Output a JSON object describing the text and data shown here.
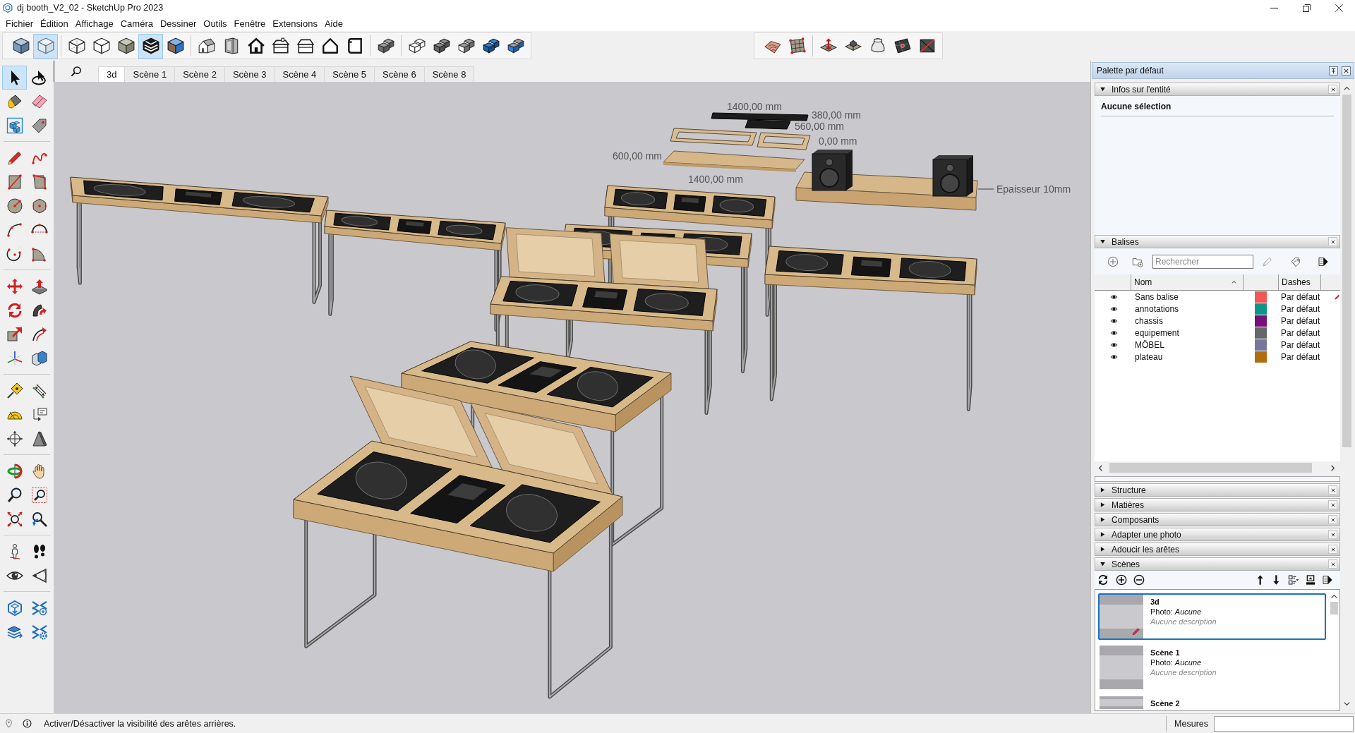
{
  "window": {
    "title": "dj booth_V2_02 - SketchUp Pro 2023"
  },
  "menu": [
    "Fichier",
    "Édition",
    "Affichage",
    "Caméra",
    "Dessiner",
    "Outils",
    "Fenêtre",
    "Extensions",
    "Aide"
  ],
  "toolbar": {
    "groups": [
      [
        {
          "selected": false
        },
        {
          "selected": true
        }
      ],
      [
        {
          "selected": false
        },
        {
          "selected": false
        },
        {
          "selected": false
        },
        {
          "selected": true
        },
        {
          "selected": false
        }
      ],
      [
        {
          "selected": false
        },
        {
          "selected": false
        },
        {
          "selected": false
        },
        {
          "selected": false
        },
        {
          "selected": false
        },
        {
          "selected": false
        },
        {
          "selected": false
        }
      ],
      [
        {
          "selected": false
        }
      ],
      [
        {
          "selected": false
        },
        {
          "selected": false
        },
        {
          "selected": false
        },
        {
          "selected": false
        },
        {
          "selected": false
        }
      ]
    ]
  },
  "sandbox_toolbar": {
    "groups": [
      [
        {
          "selected": false
        },
        {
          "selected": false
        }
      ],
      [
        {
          "selected": false
        },
        {
          "selected": false
        },
        {
          "selected": false
        },
        {
          "selected": false
        },
        {
          "selected": false
        }
      ]
    ]
  },
  "tool_palette": {
    "groups": [
      [
        {
          "selected": true
        },
        {
          "selected": false
        },
        {
          "selected": false
        },
        {
          "selected": false
        },
        {
          "selected": false
        },
        {
          "selected": false
        }
      ],
      [
        {
          "selected": false
        },
        {
          "selected": false
        },
        {
          "selected": false
        },
        {
          "selected": false
        },
        {
          "selected": false
        },
        {
          "selected": false
        },
        {
          "selected": false
        },
        {
          "selected": false
        },
        {
          "selected": false
        },
        {
          "selected": false
        }
      ],
      [
        {
          "selected": false
        },
        {
          "selected": false
        },
        {
          "selected": false
        },
        {
          "selected": false
        },
        {
          "selected": false
        },
        {
          "selected": false
        },
        {
          "selected": false
        },
        {
          "selected": false
        }
      ],
      [
        {
          "selected": false
        },
        {
          "selected": false
        },
        {
          "selected": false
        },
        {
          "selected": false
        },
        {
          "selected": false
        },
        {
          "selected": false
        }
      ],
      [
        {
          "selected": false
        },
        {
          "selected": false
        },
        {
          "selected": false
        },
        {
          "selected": false
        },
        {
          "selected": false
        },
        {
          "selected": false
        }
      ],
      [
        {
          "selected": false
        },
        {
          "selected": false
        },
        {
          "selected": false
        },
        {
          "selected": false
        }
      ],
      [
        {
          "selected": false
        },
        {
          "selected": false
        },
        {
          "selected": false
        },
        {
          "selected": false
        }
      ]
    ]
  },
  "scene_tabs": [
    {
      "label": "3d",
      "selected": true
    },
    {
      "label": "Scène 1",
      "selected": false
    },
    {
      "label": "Scène 2",
      "selected": false
    },
    {
      "label": "Scène 3",
      "selected": false
    },
    {
      "label": "Scène 4",
      "selected": false
    },
    {
      "label": "Scène 5",
      "selected": false
    },
    {
      "label": "Scène 6",
      "selected": false
    },
    {
      "label": "Scène 8",
      "selected": false
    }
  ],
  "viewport": {
    "dimension_labels": [
      "1400,00 mm",
      "380,00 mm",
      "560,00 mm",
      "0,00 mm",
      "600,00 mm",
      "1400,00 mm",
      "Epaisseur 10mm"
    ]
  },
  "tray": {
    "title": "Palette par défaut",
    "entity_info": {
      "title": "Infos sur l'entité",
      "expanded": true,
      "selection": "Aucune sélection"
    },
    "tags": {
      "title": "Balises",
      "expanded": true,
      "search": {
        "placeholder": "Rechercher"
      },
      "columns": [
        "Nom",
        "Dashes"
      ],
      "rows": [
        {
          "name": "Sans balise",
          "visible": true,
          "color": "#f25757",
          "dashes": "Par défaut",
          "active": true
        },
        {
          "name": "annotations",
          "visible": true,
          "color": "#0e9587",
          "dashes": "Par défaut",
          "active": false
        },
        {
          "name": "chassis",
          "visible": true,
          "color": "#780f7a",
          "dashes": "Par défaut",
          "active": false
        },
        {
          "name": "equipement",
          "visible": true,
          "color": "#676767",
          "dashes": "Par défaut",
          "active": false
        },
        {
          "name": "MÖBEL",
          "visible": true,
          "color": "#76769a",
          "dashes": "Par défaut",
          "active": false
        },
        {
          "name": "plateau",
          "visible": true,
          "color": "#b26c10",
          "dashes": "Par défaut",
          "active": false
        }
      ]
    },
    "panels": [
      {
        "title": "Structure",
        "expanded": false
      },
      {
        "title": "Matières",
        "expanded": false
      },
      {
        "title": "Composants",
        "expanded": false
      },
      {
        "title": "Adapter une photo",
        "expanded": false
      },
      {
        "title": "Adoucir les arêtes",
        "expanded": false
      }
    ],
    "scenes": {
      "title": "Scènes",
      "expanded": true,
      "items": [
        {
          "name": "3d",
          "photo": "Photo: *Aucune*",
          "description": "Aucune description",
          "selected": true,
          "modified": true
        },
        {
          "name": "Scène 1",
          "photo": "Photo: *Aucune*",
          "description": "Aucune description",
          "selected": false,
          "modified": false
        },
        {
          "name": "Scène 2",
          "selected": false,
          "modified": false
        }
      ]
    }
  },
  "status_bar": {
    "hint": "Activer/Désactiver la visibilité des arêtes arrières.",
    "measurements_label": "Mesures"
  }
}
